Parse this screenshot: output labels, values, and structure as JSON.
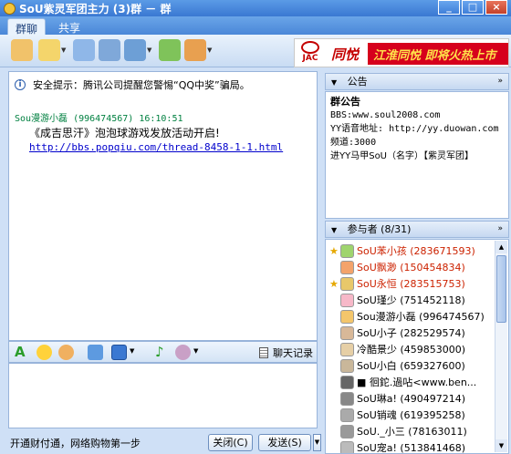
{
  "window": {
    "title": "SoU紫灵军团主力 (3)群 － 群"
  },
  "tabs": [
    {
      "label": "群聊"
    },
    {
      "label": "共享"
    }
  ],
  "ad": {
    "brand": "JAC",
    "text1": "同悦",
    "text2": "江淮同悦 即将火热上市"
  },
  "chat": {
    "notice": "安全提示：腾讯公司提醒您警惕“QQ中奖”骗局。",
    "message": {
      "sender_line": "Sou漫游小磊 (996474567) 16:10:51",
      "body": "《成吉思汗》泡泡球游戏发放活动开启!",
      "link": "http://bbs.popqiu.com/thread-8458-1-1.html"
    }
  },
  "input_toolbar": {
    "history_label": "聊天记录"
  },
  "footer": {
    "text": "开通财付通，网络购物第一步",
    "close_label": "关闭(C)",
    "send_label": "发送(S)"
  },
  "announcement": {
    "header": "公告",
    "title": "群公告",
    "lines": [
      "BBS:www.soul2008.com",
      "YY语音地址: http://yy.duowan.com频道:3000",
      "进YY马甲SoU（名字）【紫灵军团】"
    ]
  },
  "members": {
    "header": "参与者 (8/31)",
    "list": [
      {
        "name": "SoU苯小孩 (283671593)",
        "admin": true,
        "color": "#cc2200"
      },
      {
        "name": "SoU飘渺 (150454834)",
        "admin": false,
        "color": "#cc2200"
      },
      {
        "name": "SoU永恒 (283515753)",
        "admin": true,
        "color": "#cc2200"
      },
      {
        "name": "SoU瑾少 (751452118)",
        "admin": false,
        "color": "#000000"
      },
      {
        "name": "Sou漫游小磊 (996474567)",
        "admin": false,
        "color": "#000000"
      },
      {
        "name": "SoU小子 (282529574)",
        "admin": false,
        "color": "#000000"
      },
      {
        "name": "冷酷景少 (459853000)",
        "admin": false,
        "color": "#000000"
      },
      {
        "name": "SoU小白 (659327600)",
        "admin": false,
        "color": "#000000"
      },
      {
        "name": "■ 徊鉈.過呫<www.ben...",
        "admin": false,
        "color": "#000000"
      },
      {
        "name": "SoU琳a! (490497214)",
        "admin": false,
        "color": "#000000"
      },
      {
        "name": "SoU销魂 (619395258)",
        "admin": false,
        "color": "#000000"
      },
      {
        "name": "SoU._小三 (78163011)",
        "admin": false,
        "color": "#000000"
      },
      {
        "name": "SoU宠a! (513841468)",
        "admin": false,
        "color": "#000000"
      }
    ]
  },
  "colors": {
    "titlebar": "#3a78d2",
    "accent": "#cc2200",
    "link": "#0000cc",
    "time": "#008040"
  }
}
